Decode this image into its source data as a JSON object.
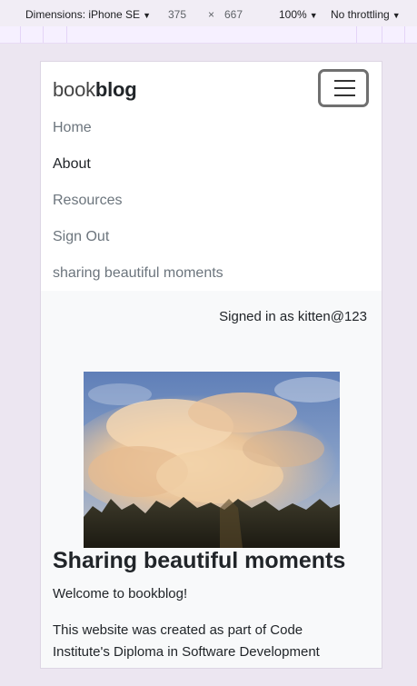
{
  "devtools": {
    "device_label": "Dimensions: iPhone SE",
    "width": "375",
    "times": "×",
    "height": "667",
    "zoom": "100%",
    "throttling": "No throttling"
  },
  "site": {
    "brand_light": "book",
    "brand_bold": "blog",
    "nav": [
      {
        "label": "Home"
      },
      {
        "label": "About"
      },
      {
        "label": "Resources"
      },
      {
        "label": "Sign Out"
      },
      {
        "label": "sharing beautiful moments"
      }
    ],
    "signed_in": "Signed in as kitten@123",
    "heading": "Sharing beautiful moments",
    "welcome": "Welcome to bookblog!",
    "description": "This website was created as part of Code Institute's Diploma in Software Development"
  },
  "colors": {
    "page_bg": "#ece6f1",
    "content_bg": "#f8f9fa",
    "nav_muted": "#6c757d",
    "text": "#212529"
  }
}
